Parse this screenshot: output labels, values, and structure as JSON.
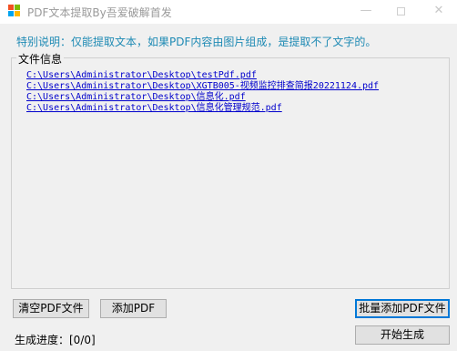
{
  "window": {
    "title": "PDF文本提取By吾爱破解首发",
    "minimize_glyph": "—",
    "close_glyph": "✕"
  },
  "notice": "特别说明：仅能提取文本，如果PDF内容由图片组成，是提取不了文字的。",
  "file_info": {
    "label": "文件信息",
    "files": [
      "C:\\Users\\Administrator\\Desktop\\testPdf.pdf",
      "C:\\Users\\Administrator\\Desktop\\XGTB005-视频监控排查简报20221124.pdf",
      "C:\\Users\\Administrator\\Desktop\\信息化.pdf",
      "C:\\Users\\Administrator\\Desktop\\信息化管理规范.pdf"
    ]
  },
  "buttons": {
    "clear": "清空PDF文件",
    "add": "添加PDF",
    "batch_add": "批量添加PDF文件",
    "start": "开始生成"
  },
  "progress": {
    "label": "生成进度：[0/0]"
  }
}
